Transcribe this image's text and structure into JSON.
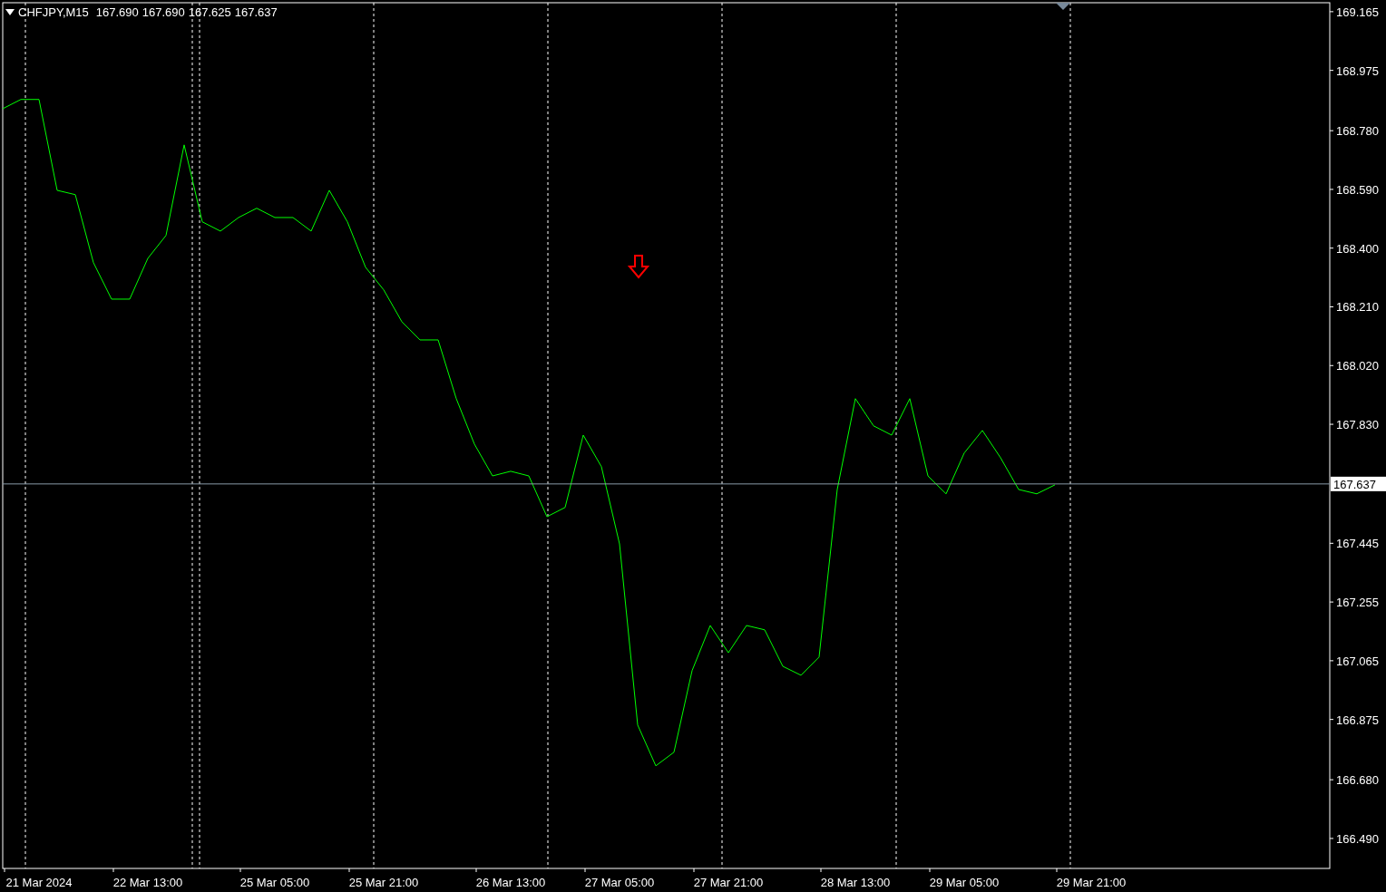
{
  "header": {
    "symbol": "CHFJPY,M15",
    "prices": [
      "167.690",
      "167.690",
      "167.625",
      "167.637"
    ]
  },
  "chart_data": {
    "type": "line",
    "categories": [
      null,
      null,
      "21 Mar 2024",
      null,
      null,
      null,
      null,
      null,
      "22 Mar 13:00",
      null,
      null,
      null,
      null,
      null,
      null,
      "25 Mar 05:00",
      null,
      null,
      null,
      null,
      null,
      "25 Mar 21:00",
      null,
      null,
      null,
      null,
      null,
      null,
      "26 Mar 13:00",
      null,
      null,
      null,
      null,
      null,
      "27 Mar 05:00",
      null,
      null,
      null,
      null,
      null,
      "27 Mar 21:00",
      null,
      null,
      null,
      null,
      null,
      null,
      "28 Mar 13:00",
      null,
      null,
      null,
      null,
      null,
      "29 Mar 05:00",
      null,
      null,
      null,
      null,
      null,
      null,
      "29 Mar 21:00"
    ],
    "series": [
      {
        "color": "#00ff00",
        "values": [
          168.851,
          168.881,
          168.881,
          168.587,
          168.573,
          168.353,
          168.235,
          168.235,
          168.367,
          168.441,
          168.734,
          168.485,
          168.455,
          168.499,
          168.529,
          168.499,
          168.499,
          168.455,
          168.587,
          168.485,
          168.338,
          168.265,
          168.162,
          168.103,
          168.103,
          167.913,
          167.766,
          167.663,
          167.678,
          167.663,
          167.531,
          167.561,
          167.795,
          167.693,
          167.443,
          166.857,
          166.725,
          166.769,
          167.033,
          167.179,
          167.091,
          167.179,
          167.165,
          167.047,
          167.018,
          167.077,
          167.619,
          167.913,
          167.825,
          167.795,
          167.913,
          167.663,
          167.605,
          167.737,
          167.81,
          167.722,
          167.619,
          167.605,
          167.634,
          null,
          null
        ]
      }
    ],
    "ylim": [
      166.393,
      169.194
    ],
    "grid": true,
    "yticks": [
      {
        "value": 169.165,
        "label": "169.165"
      },
      {
        "value": 168.975,
        "label": "168.975"
      },
      {
        "value": 168.78,
        "label": "168.780"
      },
      {
        "value": 168.59,
        "label": "168.590"
      },
      {
        "value": 168.4,
        "label": "168.400"
      },
      {
        "value": 168.21,
        "label": "168.210"
      },
      {
        "value": 168.02,
        "label": "168.020"
      },
      {
        "value": 167.83,
        "label": "167.830"
      },
      {
        "value": 167.445,
        "label": "167.445"
      },
      {
        "value": 167.255,
        "label": "167.255"
      },
      {
        "value": 167.065,
        "label": "167.065"
      },
      {
        "value": 166.875,
        "label": "166.875"
      },
      {
        "value": 166.68,
        "label": "166.680"
      },
      {
        "value": 166.49,
        "label": "166.490"
      }
    ],
    "ref_lines": [
      {
        "axis": "y",
        "value": 167.637,
        "label": "167.637"
      }
    ]
  }
}
